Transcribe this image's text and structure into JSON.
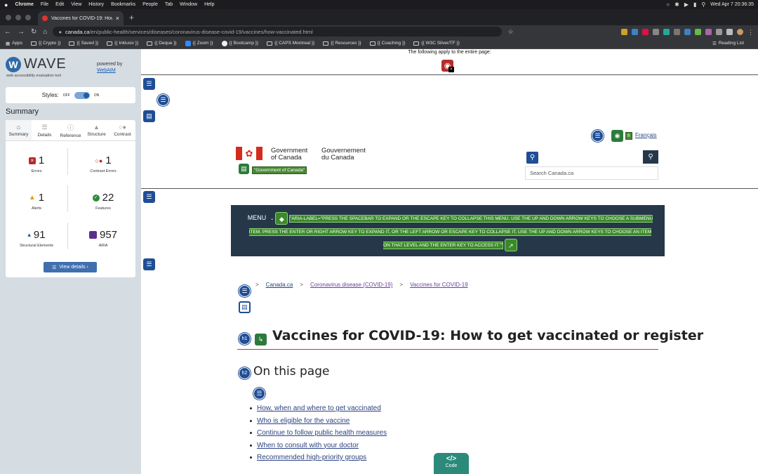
{
  "macos": {
    "apple": "",
    "app": "Chrome",
    "menus": [
      "File",
      "Edit",
      "View",
      "History",
      "Bookmarks",
      "People",
      "Tab",
      "Window",
      "Help"
    ],
    "clock": "Wed Apr 7  20:36:35"
  },
  "browser": {
    "tab_title": "Vaccines for COVID-19: How to",
    "url_host": "canada.ca",
    "url_path": "/en/public-health/services/diseases/coronavirus-disease-covid-19/vaccines/how-vaccinated.html",
    "bookmarks": [
      "Apps",
      "{{ Crypto }}",
      "{{ Saved }}",
      "{{ Inklusiv }}",
      "{{ Deque }}",
      "{{ Zoom }}",
      "{{ Bootcamp }}",
      "{{ CAPS Montreal }}",
      "{{ Resources }}",
      "{{ Coaching }}",
      "{{ W3C Silver/TF }}"
    ],
    "reading_list": "Reading List"
  },
  "wave": {
    "logo_name": "WAVE",
    "tagline": "web accessibility evaluation tool",
    "powered_by": "powered by",
    "webaim": "WebAIM",
    "styles_label": "Styles:",
    "off": "OFF",
    "on": "ON",
    "summary_title": "Summary",
    "tabs": [
      {
        "label": "Summary",
        "icon": "home-icon",
        "active": true
      },
      {
        "label": "Details",
        "icon": "list-icon",
        "active": false
      },
      {
        "label": "Reference",
        "icon": "info-icon",
        "active": false
      },
      {
        "label": "Structure",
        "icon": "tree-icon",
        "active": false
      },
      {
        "label": "Contrast",
        "icon": "contrast-icon",
        "active": false
      }
    ],
    "stats": {
      "errors": {
        "count": "1",
        "label": "Errors"
      },
      "contrast_errors": {
        "count": "1",
        "label": "Contrast Errors"
      },
      "alerts": {
        "count": "1",
        "label": "Alerts"
      },
      "features": {
        "count": "22",
        "label": "Features"
      },
      "structural": {
        "count": "91",
        "label": "Structural Elements"
      },
      "aria": {
        "count": "957",
        "label": "ARIA"
      }
    },
    "view_details": "View details ›"
  },
  "page": {
    "applies_entire": "The following apply to the entire page:",
    "francais": "Français",
    "lang_tag": "fr",
    "gov_en": "Government\nof Canada",
    "gov_fr": "Gouvernement\ndu Canada",
    "gov_alt": "\"Government of Canada\"",
    "search_placeholder": "Search Canada.ca",
    "menu_label": "MENU",
    "aria_label_text": "\"ARIA-LABEL=\"PRESS THE SPACEBAR TO EXPAND OR THE ESCAPE KEY TO COLLAPSE THIS MENU. USE THE UP AND DOWN ARROW KEYS TO CHOOSE A SUBMENU ITEM. PRESS THE ENTER OR RIGHT ARROW KEY TO EXPAND IT, OR THE LEFT ARROW OR ESCAPE KEY TO COLLAPSE IT. USE THE UP AND DOWN ARROW KEYS TO CHOOSE AN ITEM ON THAT LEVEL AND THE ENTER KEY TO ACCESS IT.\"\"",
    "breadcrumbs": [
      "Canada.ca",
      "Coronavirus disease (COVID-19)",
      "Vaccines for COVID-19"
    ],
    "h1_badge": "h1",
    "h1": "Vaccines for COVID-19: How to get vaccinated or register",
    "h2_badge": "h2",
    "h2": "On this page",
    "toc": [
      "How, when and where to get vaccinated",
      "Who is eligible for the vaccine",
      "Continue to follow public health measures",
      "When to consult with your doctor",
      "Recommended high-priority groups"
    ],
    "code_glyph": "</>",
    "code_label": "Code"
  },
  "colors": {
    "wave_blue": "#1f4e96",
    "gc_navy": "#26374a",
    "gc_red": "#d52b1e",
    "error_red": "#b52b2b",
    "alert_orange": "#e89a1c",
    "feature_green": "#2d8a3a",
    "aria_purple": "#5b2f8e"
  }
}
